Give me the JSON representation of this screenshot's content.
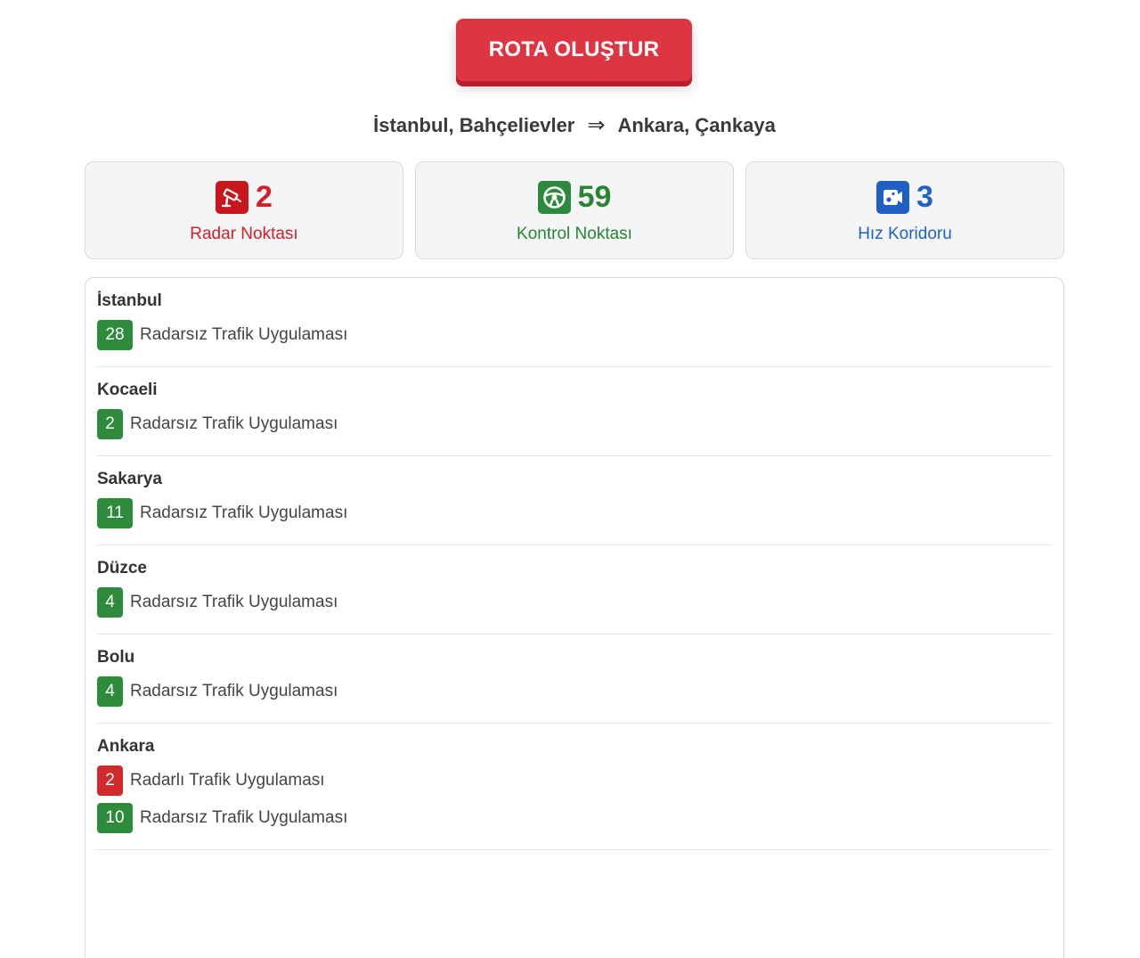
{
  "button": {
    "label": "ROTA OLUŞTUR"
  },
  "route": {
    "from": "İstanbul, Bahçelievler",
    "arrow": "⇒",
    "to": "Ankara, Çankaya"
  },
  "stats": [
    {
      "count": "2",
      "label": "Radar Noktası",
      "icon": "radar-camera-icon",
      "color": "#d02126"
    },
    {
      "count": "59",
      "label": "Kontrol Noktası",
      "icon": "steering-wheel-icon",
      "color": "#2a8434"
    },
    {
      "count": "3",
      "label": "Hız Koridoru",
      "icon": "speed-camera-icon",
      "color": "#1f62c3"
    }
  ],
  "cities": [
    {
      "name": "İstanbul",
      "rows": [
        {
          "count": "28",
          "text": "Radarsız Trafik Uygulaması",
          "type": "green"
        }
      ]
    },
    {
      "name": "Kocaeli",
      "rows": [
        {
          "count": "2",
          "text": "Radarsız Trafik Uygulaması",
          "type": "green"
        }
      ]
    },
    {
      "name": "Sakarya",
      "rows": [
        {
          "count": "11",
          "text": "Radarsız Trafik Uygulaması",
          "type": "green"
        }
      ]
    },
    {
      "name": "Düzce",
      "rows": [
        {
          "count": "4",
          "text": "Radarsız Trafik Uygulaması",
          "type": "green"
        }
      ]
    },
    {
      "name": "Bolu",
      "rows": [
        {
          "count": "4",
          "text": "Radarsız Trafik Uygulaması",
          "type": "green"
        }
      ]
    },
    {
      "name": "Ankara",
      "rows": [
        {
          "count": "2",
          "text": "Radarlı Trafik Uygulaması",
          "type": "red"
        },
        {
          "count": "10",
          "text": "Radarsız Trafik Uygulaması",
          "type": "green"
        }
      ]
    }
  ]
}
